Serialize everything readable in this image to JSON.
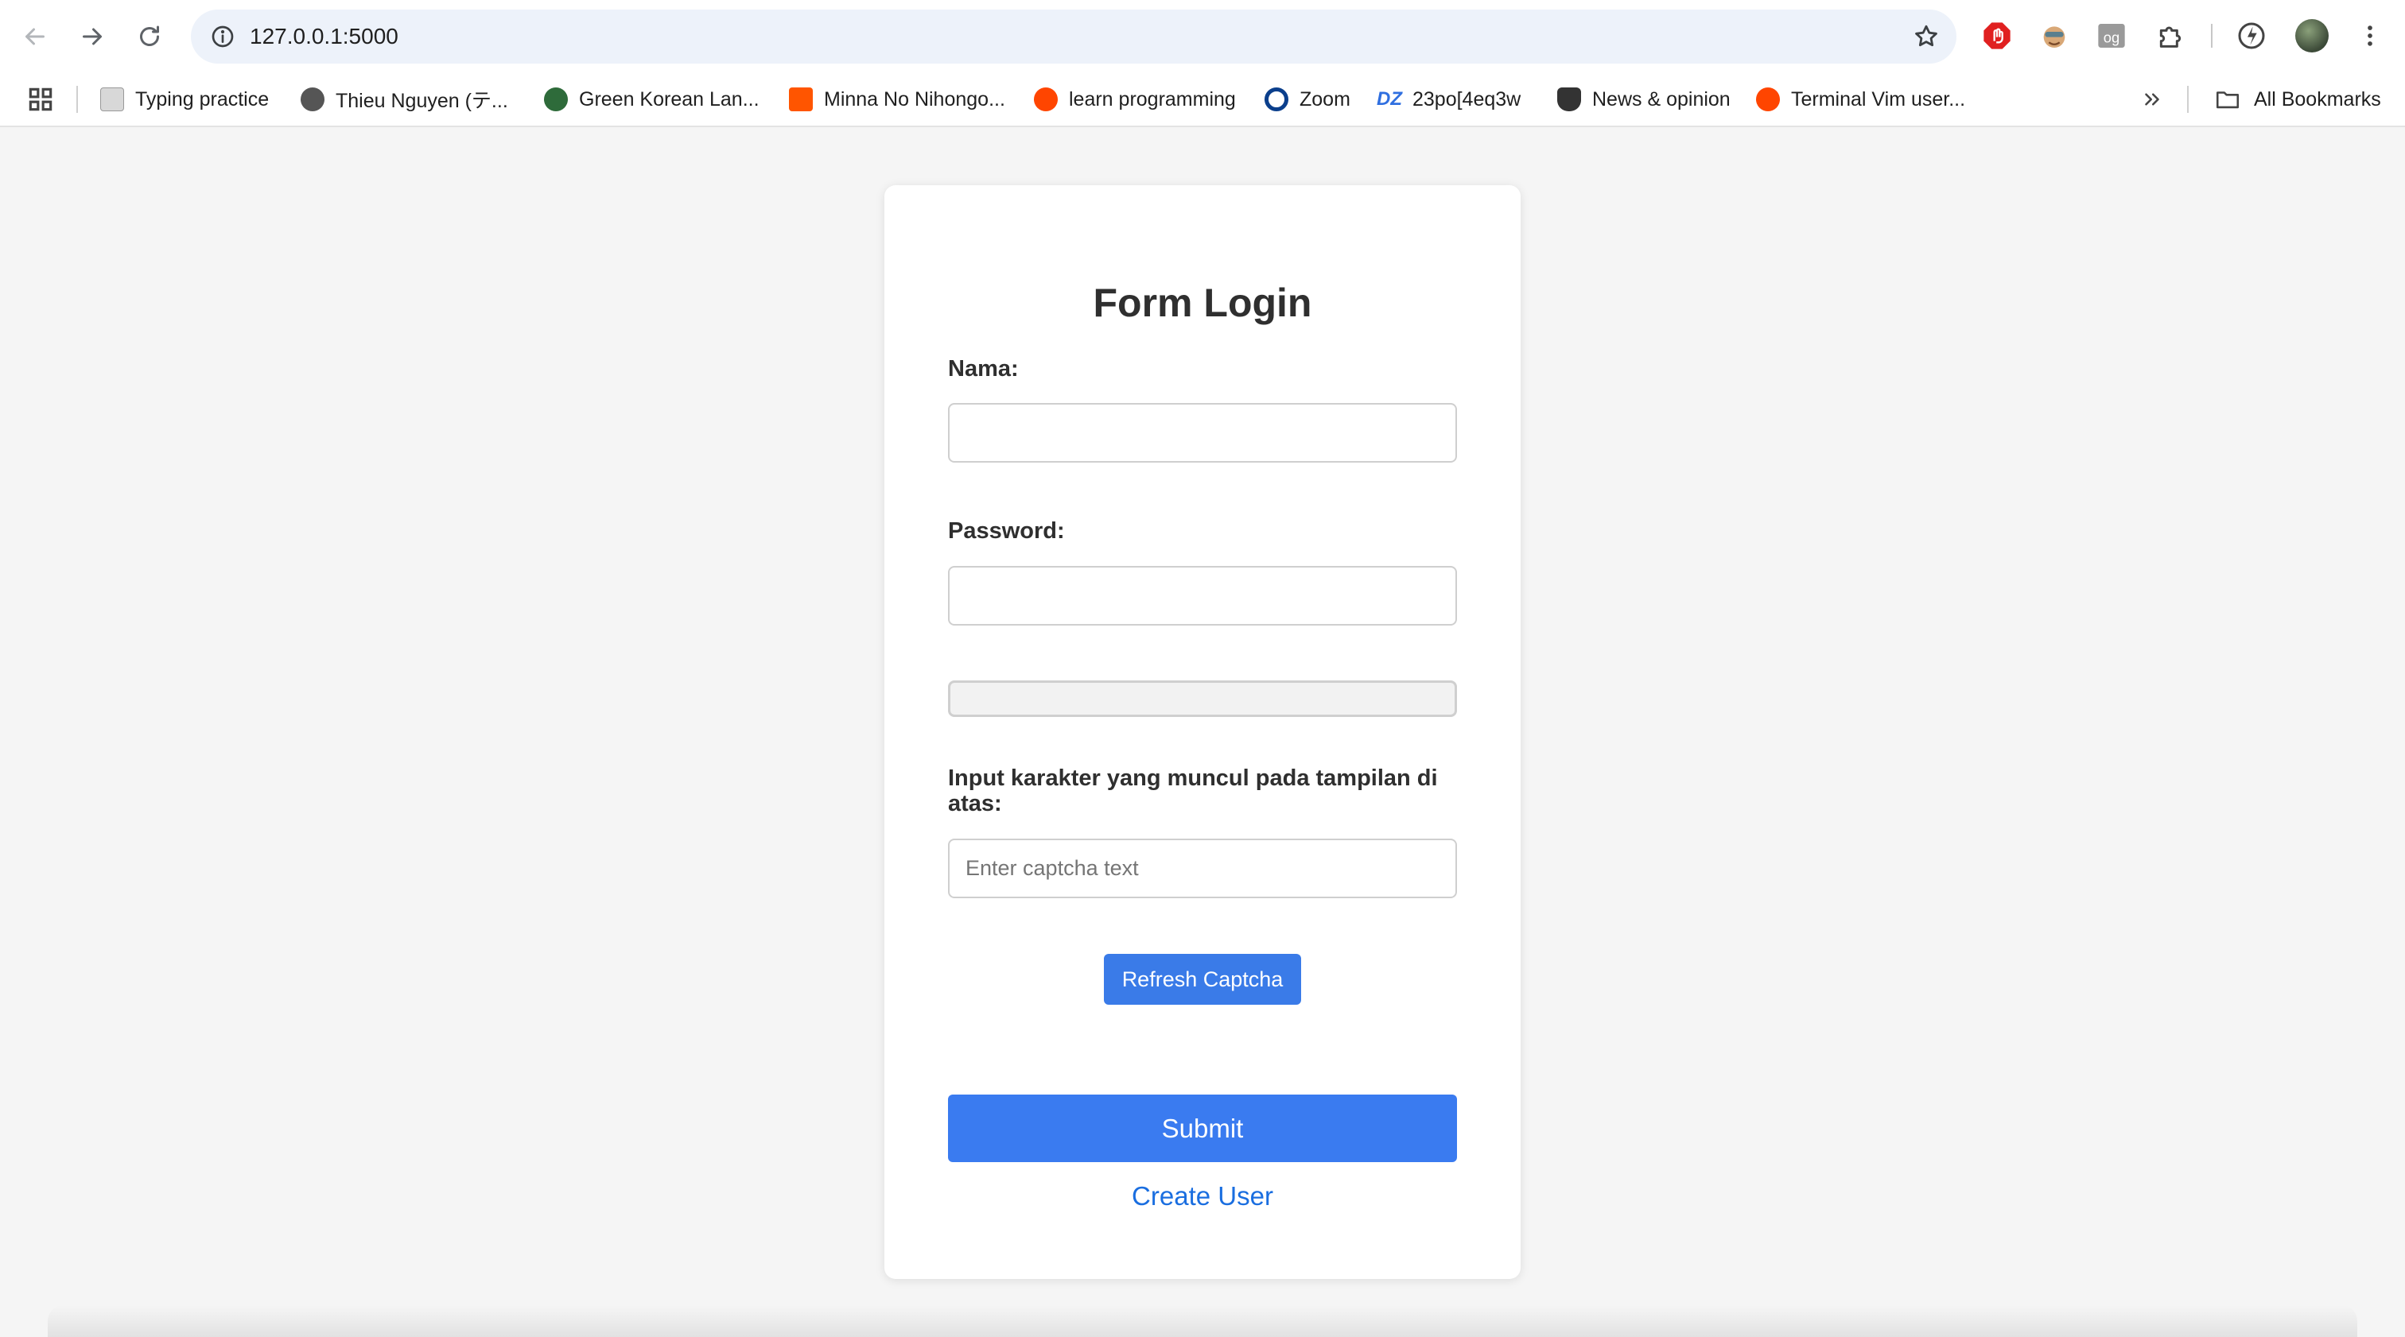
{
  "browser": {
    "url": "127.0.0.1:5000"
  },
  "bookmarks": {
    "items": [
      {
        "label": "Typing practice",
        "icon": "typing-favicon",
        "color": "#8a8a8a"
      },
      {
        "label": "Thieu Nguyen (テ...",
        "icon": "globe-favicon",
        "color": "#555555"
      },
      {
        "label": "Green Korean Lan...",
        "icon": "leaf-favicon",
        "color": "#2e6b3a"
      },
      {
        "label": "Minna No Nihongo...",
        "icon": "soundcloud-favicon",
        "color": "#ff5500"
      },
      {
        "label": "learn programming",
        "icon": "reddit-favicon",
        "color": "#ff4500"
      },
      {
        "label": "Zoom",
        "icon": "zoom-favicon",
        "color": "#0b3f8c"
      },
      {
        "label": "23po[4eq3w",
        "icon": "dz-favicon",
        "color": "#2f6fe0"
      },
      {
        "label": "News & opinion",
        "icon": "shield-favicon",
        "color": "#333333"
      },
      {
        "label": "Terminal Vim user...",
        "icon": "reddit-favicon",
        "color": "#ff4500"
      }
    ],
    "all_label": "All Bookmarks"
  },
  "form": {
    "title": "Form Login",
    "name_label": "Nama:",
    "name_value": "",
    "password_label": "Password:",
    "password_value": "",
    "captcha_label": "Input karakter yang muncul pada tampilan di atas:",
    "captcha_placeholder": "Enter captcha text",
    "refresh_label": "Refresh Captcha",
    "submit_label": "Submit",
    "create_user_label": "Create User"
  },
  "colors": {
    "primary_button": "#3a7bf0",
    "link": "#1a6ee0",
    "page_background": "#f5f5f5"
  }
}
